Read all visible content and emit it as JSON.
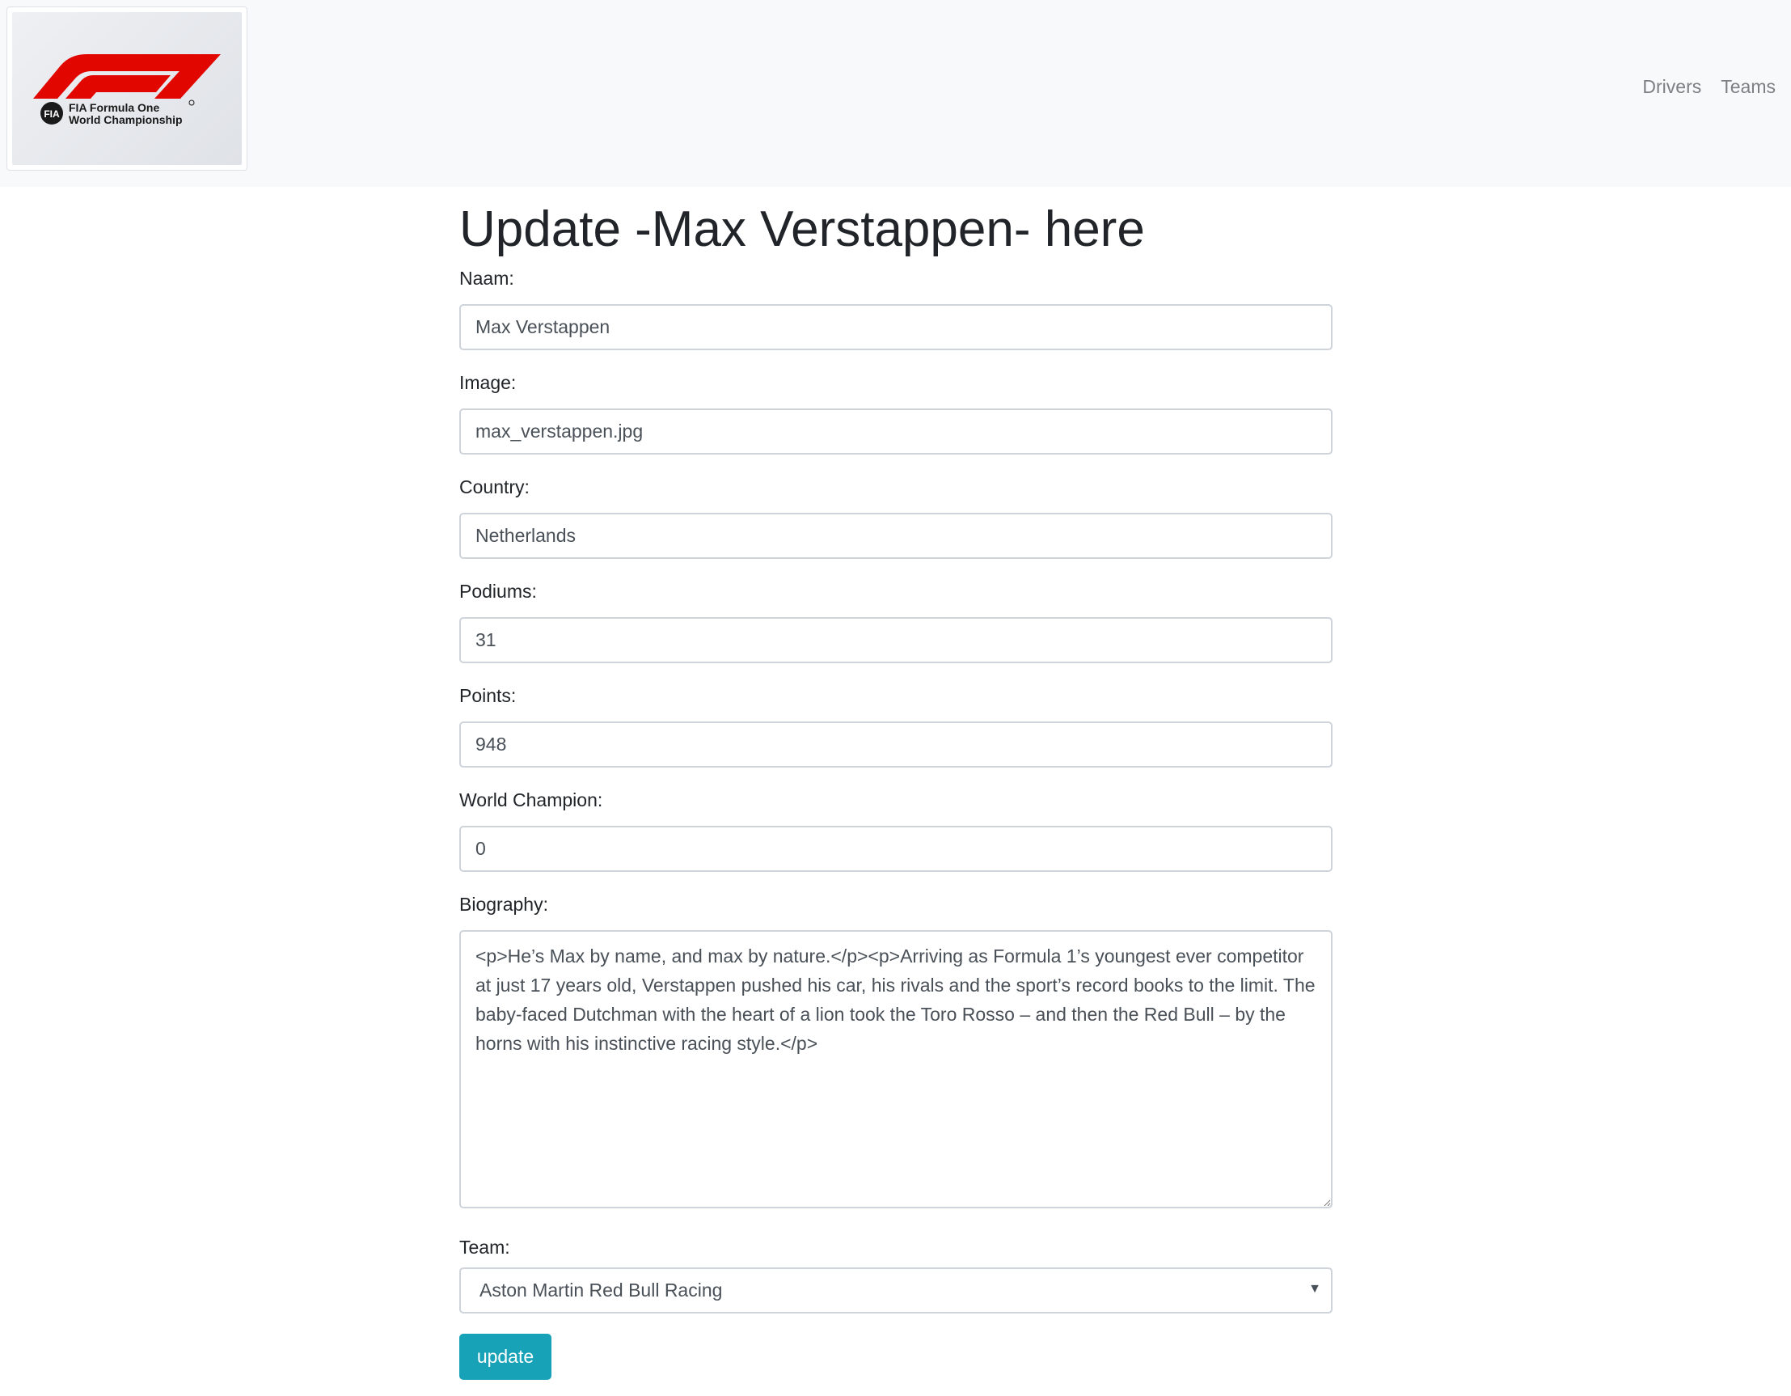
{
  "nav": {
    "logo": {
      "line1": "FIA Formula One",
      "line2": "World Championship",
      "emblem": "FIA"
    },
    "links": [
      {
        "label": "Drivers"
      },
      {
        "label": "Teams"
      }
    ]
  },
  "form": {
    "title": "Update -Max Verstappen- here",
    "fields": {
      "naam": {
        "label": "Naam:",
        "value": "Max Verstappen"
      },
      "image": {
        "label": "Image:",
        "value": "max_verstappen.jpg"
      },
      "country": {
        "label": "Country:",
        "value": "Netherlands"
      },
      "podiums": {
        "label": "Podiums:",
        "value": "31"
      },
      "points": {
        "label": "Points:",
        "value": "948"
      },
      "world_champion": {
        "label": "World Champion:",
        "value": "0"
      },
      "biography": {
        "label": "Biography:",
        "value": "<p>He’s Max by name, and max by nature.</p><p>Arriving as Formula 1’s youngest ever competitor at just 17 years old, Verstappen pushed his car, his rivals and the sport’s record books to the limit. The baby-faced Dutchman with the heart of a lion took the Toro Rosso – and then the Red Bull – by the horns with his instinctive racing style.</p>"
      },
      "team": {
        "label": "Team:",
        "value": "Aston Martin Red Bull Racing"
      }
    },
    "submit_label": "update"
  },
  "colors": {
    "navbar_bg": "#f8f9fa",
    "button_bg": "#17a2b8",
    "f1_red": "#e10600"
  }
}
